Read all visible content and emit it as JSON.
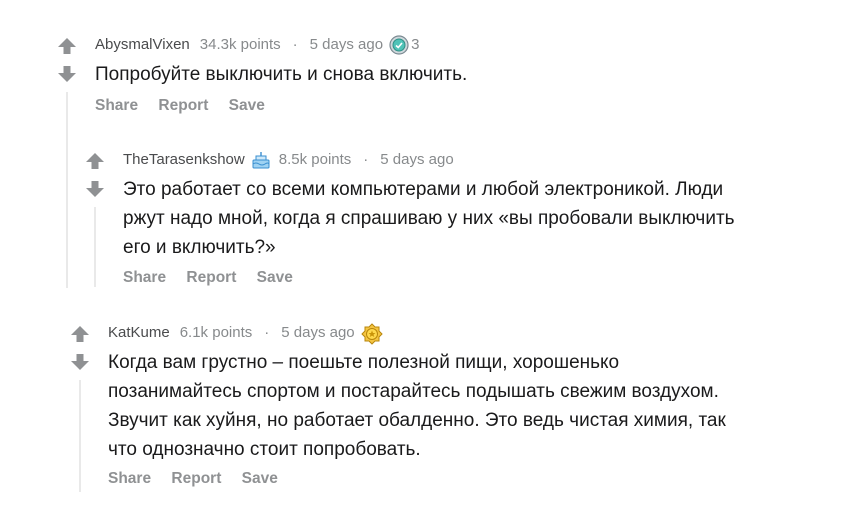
{
  "comments": [
    {
      "author": "AbysmalVixen",
      "points": "34.3k points",
      "separator": "·",
      "time": "5 days ago",
      "award_icon": "platinum-award-icon",
      "award_count": "3",
      "text": "Попробуйте выключить и снова включить.",
      "actions": {
        "share": "Share",
        "report": "Report",
        "save": "Save"
      }
    },
    {
      "author": "TheTarasenkshow",
      "points": "8.5k points",
      "separator": "·",
      "time": "5 days ago",
      "flair_icon": "cake-icon",
      "text_lines": [
        "Это работает со всеми компьютерами и любой электроникой. Люди",
        "ржут надо мной, когда я спрашиваю у них «вы пробовали выключить",
        "его и включить?»"
      ],
      "actions": {
        "share": "Share",
        "report": "Report",
        "save": "Save"
      }
    },
    {
      "author": "KatKume",
      "points": "6.1k points",
      "separator": "·",
      "time": "5 days ago",
      "award_icon": "gold-award-icon",
      "text_lines": [
        "Когда вам грустно – поешьте полезной пищи, хорошенько",
        "позанимайтесь спортом и постарайтесь подышать свежим воздухом.",
        "Звучит как хуйня, но работает обалденно. Это ведь чистая химия, так",
        "что однозначно стоит попробовать."
      ],
      "actions": {
        "share": "Share",
        "report": "Report",
        "save": "Save"
      }
    }
  ],
  "colors": {
    "arrow": "#8f9193",
    "text": "#1a1a1b",
    "meta": "#878a8c",
    "thread_line": "#e9e9e9"
  }
}
